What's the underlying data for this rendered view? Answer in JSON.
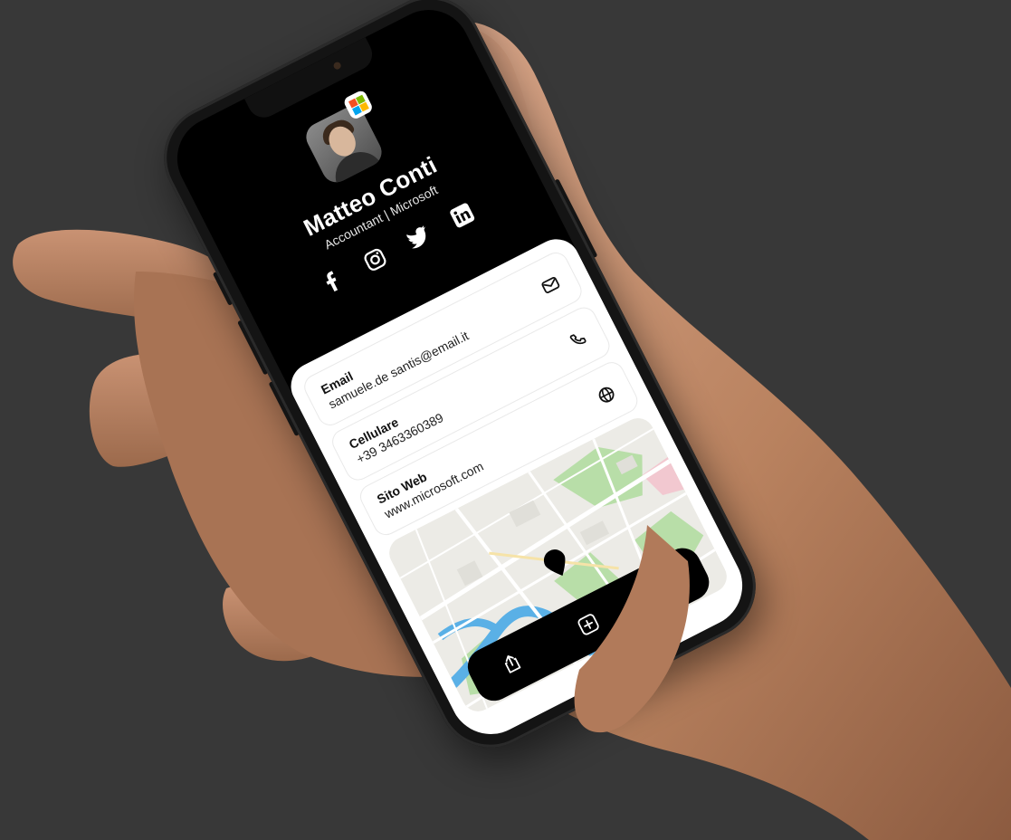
{
  "profile": {
    "name": "Matteo Conti",
    "role": "Accountant | Microsoft",
    "avatar_icon": "person-avatar",
    "brand_icon": "microsoft-logo",
    "brand_colors": [
      "#f25022",
      "#7fba00",
      "#00a4ef",
      "#ffb900"
    ]
  },
  "socials": [
    {
      "icon": "facebook-icon"
    },
    {
      "icon": "instagram-icon"
    },
    {
      "icon": "twitter-icon"
    },
    {
      "icon": "linkedin-icon"
    }
  ],
  "contacts": [
    {
      "label": "Email",
      "value": "samuele.de santis@email.it",
      "icon": "mail-icon"
    },
    {
      "label": "Cellulare",
      "value": "+39 3463360389",
      "icon": "phone-icon"
    },
    {
      "label": "Sito Web",
      "value": "www.microsoft.com",
      "icon": "globe-icon"
    }
  ],
  "map": {
    "marker_icon": "map-pin-icon"
  },
  "bottom_bar": [
    {
      "icon": "share-icon"
    },
    {
      "icon": "add-contact-icon"
    },
    {
      "icon": "qr-code-icon"
    }
  ],
  "colors": {
    "background": "#383838",
    "screen_header": "#000000",
    "sheet": "#ffffff",
    "bar": "#000000",
    "river": "#5ab0e6",
    "park": "#a9d99b"
  }
}
